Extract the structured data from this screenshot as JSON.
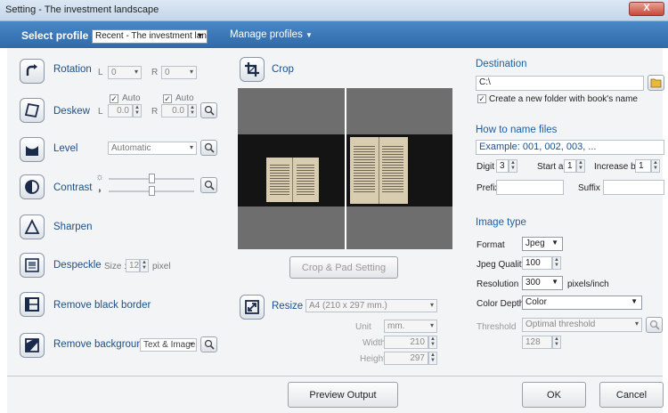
{
  "window": {
    "title": "Setting - The investment landscape",
    "close": "X"
  },
  "profile": {
    "label": "Select profile",
    "selected": "Recent - The investment landscape",
    "manage": "Manage profiles"
  },
  "rotation": {
    "label": "Rotation",
    "l": "L",
    "l_val": "0",
    "r": "R",
    "r_val": "0"
  },
  "deskew": {
    "label": "Deskew",
    "auto": "Auto",
    "l": "L",
    "l_val": "0.0",
    "r": "R",
    "r_val": "0.0"
  },
  "level": {
    "label": "Level",
    "value": "Automatic"
  },
  "contrast": {
    "label": "Contrast"
  },
  "sharpen": {
    "label": "Sharpen"
  },
  "despeckle": {
    "label": "Despeckle",
    "size_label": "Size :",
    "size_val": "12",
    "unit": "pixel"
  },
  "black_border": {
    "label": "Remove black border"
  },
  "background": {
    "label": "Remove background",
    "value": "Text & Image"
  },
  "crop": {
    "label": "Crop",
    "button": "Crop & Pad Setting"
  },
  "resize": {
    "label": "Resize",
    "value": "A4 (210 x 297 mm.)",
    "unit_label": "Unit",
    "unit_val": "mm.",
    "width_label": "Width",
    "width_val": "210",
    "height_label": "Height",
    "height_val": "297"
  },
  "destination": {
    "title": "Destination",
    "path": "C:\\",
    "create_folder": "Create a new folder with book's name"
  },
  "naming": {
    "title": "How to name files",
    "example": "Example: 001, 002, 003, ...",
    "digit_label": "Digit",
    "digit_val": "3",
    "start_label": "Start at",
    "start_val": "1",
    "inc_label": "Increase by",
    "inc_val": "1",
    "prefix_label": "Prefix",
    "suffix_label": "Suffix"
  },
  "image_type": {
    "title": "Image type",
    "format_label": "Format",
    "format_val": "Jpeg",
    "quality_label": "Jpeg Quality:",
    "quality_val": "100",
    "res_label": "Resolution",
    "res_val": "300",
    "res_unit": "pixels/inch",
    "depth_label": "Color Depth",
    "depth_val": "Color",
    "threshold_label": "Threshold",
    "threshold_val": "Optimal threshold",
    "threshold_num": "128"
  },
  "footer": {
    "preview": "Preview Output",
    "ok": "OK",
    "cancel": "Cancel"
  }
}
